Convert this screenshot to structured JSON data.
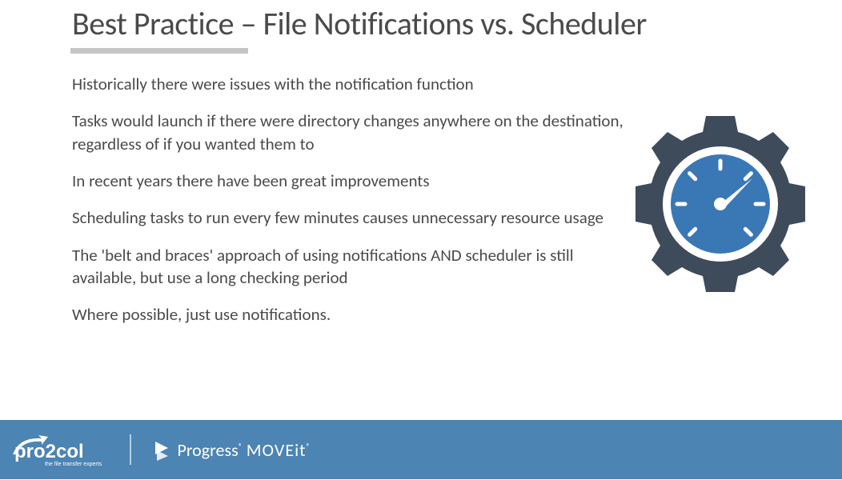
{
  "slide": {
    "title": "Best Practice – File Notifications vs. Scheduler",
    "paragraphs": [
      "Historically there were issues with the notification function",
      "Tasks would launch if there were directory changes anywhere on the destination, regardless of if you wanted them to",
      "In recent years there have been great improvements",
      "Scheduling tasks to run every few minutes causes unnecessary resource usage",
      "The 'belt and braces' approach of using notifications AND scheduler is still available, but use a long checking period",
      "Where possible, just use notifications."
    ],
    "graphic": "gear-speedometer-icon",
    "footer": {
      "logo1_brand": "pro2col",
      "logo1_tagline": "the file transfer experts",
      "logo2_brand": "Progress",
      "logo2_product": "MOVEit"
    },
    "colors": {
      "title": "#4a4a4a",
      "underline": "#c5c5c5",
      "text": "#4a4a4a",
      "footer_bg": "#4c84b3",
      "gear": "#3d4b5a",
      "gauge": "#3a78b5"
    }
  }
}
